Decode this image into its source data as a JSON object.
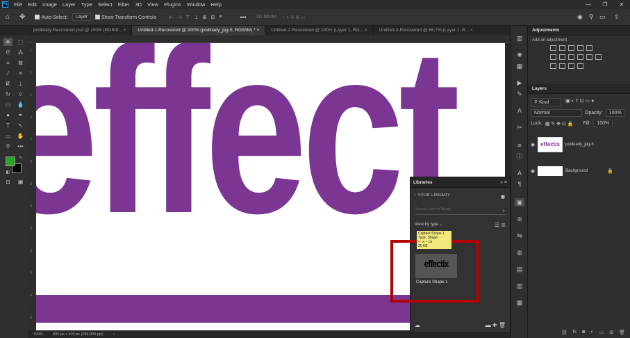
{
  "menu": [
    "File",
    "Edit",
    "Image",
    "Layer",
    "Type",
    "Select",
    "Filter",
    "3D",
    "View",
    "Plugins",
    "Window",
    "Help"
  ],
  "app_logo": "Ps",
  "options": {
    "auto_select_label": "Auto-Select:",
    "auto_select_value": "Layer",
    "show_transform_label": "Show Transform Controls",
    "mode_3d_label": "3D Mode:"
  },
  "tabs": [
    {
      "label": "podklady-Recovered.psd @ 100% (RGB/8...",
      "active": false
    },
    {
      "label": "Untitled-1-Recovered @ 300% (podklady_jpg-5, RGB/8#) *",
      "active": true
    },
    {
      "label": "Untitled-2-Recovered @ 100% (Layer 1, RG...",
      "active": false
    },
    {
      "label": "Untitled-3-Recovered @ 66,7% (Layer 1, R...",
      "active": false
    }
  ],
  "canvas": {
    "text": "effect",
    "text_color": "#7b3694",
    "bar_color": "#7b3694"
  },
  "colors": {
    "foreground": "#2aa32a",
    "background": "#000000",
    "highlight": "#b30000"
  },
  "ruler_left_labels": [
    "1",
    "1",
    "1",
    "2",
    "2",
    "2",
    "3",
    "3",
    "3",
    "3",
    "4",
    "4",
    "4"
  ],
  "status": {
    "zoom": "300%",
    "doc_size": "800 px x 300 px (299,999 ppi)"
  },
  "adjustments": {
    "title": "Adjustments",
    "subtitle": "Add an adjustment"
  },
  "layers": {
    "title": "Layers",
    "filter_label": "Kind",
    "blend_mode": "Normal",
    "opacity_label": "Opacity:",
    "opacity_value": "100%",
    "lock_label": "Lock:",
    "fill_label": "Fill:",
    "fill_value": "100%",
    "items": [
      {
        "name": "podklady_jpg-5",
        "thumb_text": "effectix"
      },
      {
        "name": "Background"
      }
    ]
  },
  "libraries": {
    "title": "Libraries",
    "back_label": "YOUR LIBRARY",
    "search_placeholder": "Search current library",
    "view_by_label": "View by type",
    "tooltip_lines": [
      "Capture Shape 1",
      "Type: Shape",
      "--- x -- px",
      "25 KB"
    ],
    "item_thumb_text": "effectix",
    "item_label": "Capture Shape 1"
  }
}
